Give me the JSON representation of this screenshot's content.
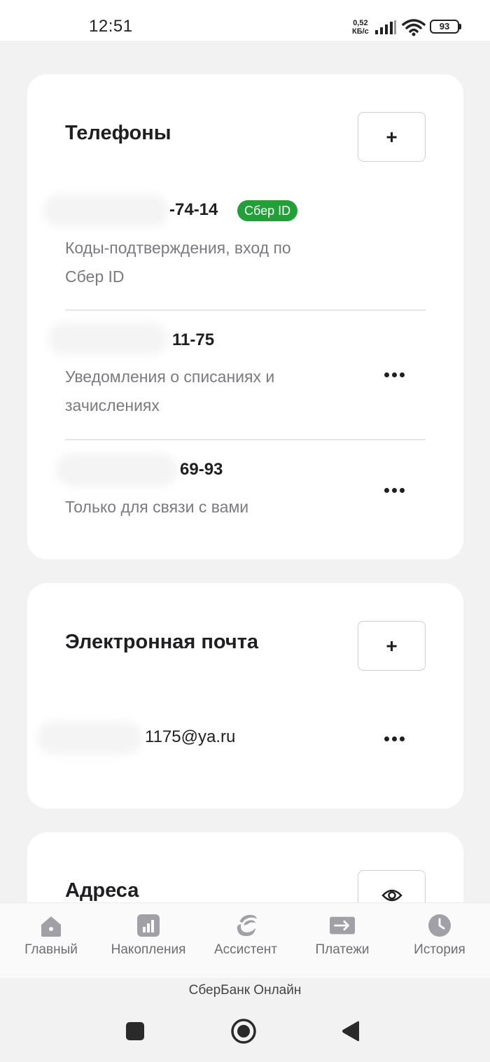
{
  "status_bar": {
    "time": "12:51",
    "net_speed_value": "0,52",
    "net_speed_unit": "КБ/с",
    "battery": "93"
  },
  "phones": {
    "title": "Телефоны",
    "add_label": "+",
    "items": [
      {
        "number_suffix": "-74-14",
        "badge": "Сбер ID",
        "description": "Коды-подтверждения, вход по Сбер ID"
      },
      {
        "number_suffix": "11-75",
        "description": "Уведомления о списаниях и зачислениях"
      },
      {
        "number_suffix": "69-93",
        "description": "Только для связи с вами"
      }
    ]
  },
  "email": {
    "title": "Электронная почта",
    "add_label": "+",
    "address_suffix": "1175@ya.ru"
  },
  "addresses": {
    "title": "Адреса"
  },
  "bottom_nav": [
    {
      "label": "Главный",
      "icon": "home-icon"
    },
    {
      "label": "Накопления",
      "icon": "savings-chart-icon"
    },
    {
      "label": "Ассистент",
      "icon": "assistant-icon"
    },
    {
      "label": "Платежи",
      "icon": "payments-arrow-icon"
    },
    {
      "label": "История",
      "icon": "history-clock-icon"
    }
  ],
  "app_caption": "СберБанк Онлайн",
  "colors": {
    "accent_green": "#21a038",
    "background": "#f2f2f2",
    "card": "#ffffff",
    "secondary_text": "#7a7a80"
  }
}
